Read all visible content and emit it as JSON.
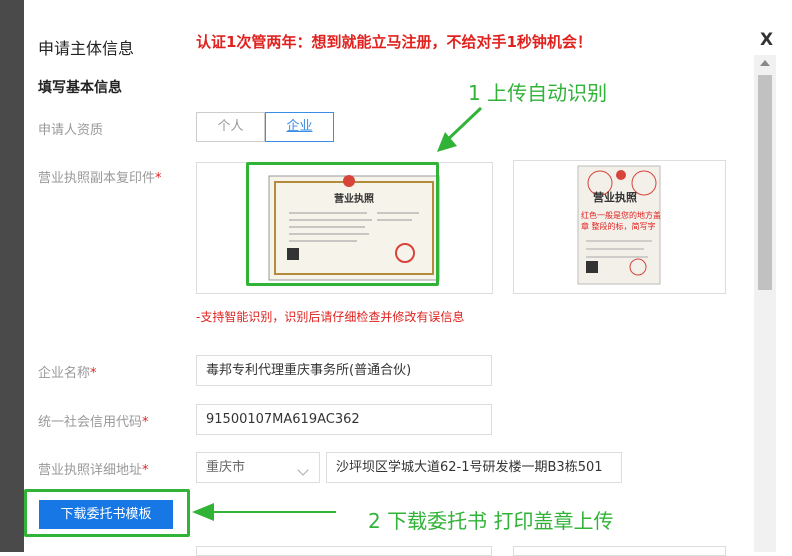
{
  "header": {
    "title": "申请主体信息",
    "promo": "认证1次管两年：想到就能立马注册，不给对手1秒钟机会！",
    "close_label": "X"
  },
  "section_title": "填写基本信息",
  "applicant_type": {
    "label": "申请人资质",
    "options": [
      "个人",
      "企业"
    ],
    "selected": "企业"
  },
  "license": {
    "label": "营业执照副本复印件",
    "required_mark": "*",
    "uploaded_title": "营业执照",
    "sample_title": "营业执照",
    "sample_note": "红色一般是您的地方盖章 整段的标，简写字",
    "hint": "-支持智能识别，识别后请仔细检查并修改有误信息"
  },
  "company_name": {
    "label": "企业名称",
    "required_mark": "*",
    "value": "毒邦专利代理重庆事务所(普通合伙)"
  },
  "credit_code": {
    "label": "统一社会信用代码",
    "required_mark": "*",
    "value": "91500107MA619AC362"
  },
  "address": {
    "label": "营业执照详细地址",
    "required_mark": "*",
    "city": "重庆市",
    "detail": "沙坪坝区学城大道62-1号研发楼一期B3栋501"
  },
  "download_button": "下载委托书模板",
  "annotations": {
    "step1": "1 上传自动识别",
    "step2": "2 下载委托书  打印盖章上传"
  },
  "colors": {
    "accent": "#1677e5",
    "annotation_green": "#31b338",
    "alert_red": "#e0221f"
  }
}
